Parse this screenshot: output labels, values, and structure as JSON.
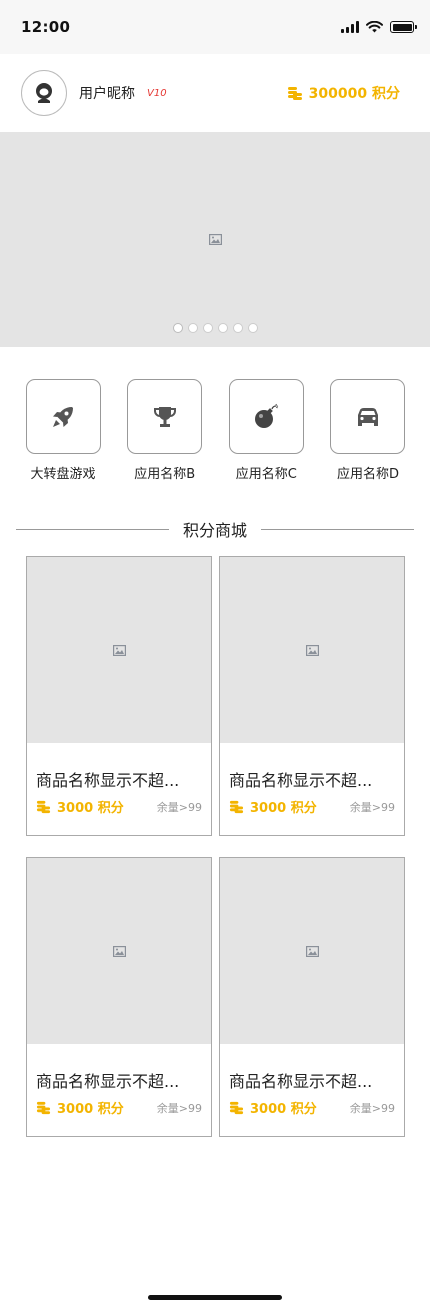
{
  "status_bar": {
    "time": "12:00"
  },
  "user": {
    "nickname": "用户昵称",
    "vip_label": "V10",
    "points": "300000 积分"
  },
  "banner": {
    "dot_count": 6,
    "active_dot": 0
  },
  "apps": [
    {
      "label": "大转盘游戏",
      "icon": "rocket-icon"
    },
    {
      "label": "应用名称B",
      "icon": "trophy-icon"
    },
    {
      "label": "应用名称C",
      "icon": "bomb-icon"
    },
    {
      "label": "应用名称D",
      "icon": "car-icon"
    }
  ],
  "section": {
    "title": "积分商城"
  },
  "products": [
    {
      "name": "商品名称显示不超...",
      "points": "3000 积分",
      "stock": "余量>99"
    },
    {
      "name": "商品名称显示不超...",
      "points": "3000 积分",
      "stock": "余量>99"
    },
    {
      "name": "商品名称显示不超...",
      "points": "3000 积分",
      "stock": "余量>99"
    },
    {
      "name": "商品名称显示不超...",
      "points": "3000 积分",
      "stock": "余量>99"
    }
  ],
  "colors": {
    "accent_gold": "#f3b400",
    "vip_red": "#e53935",
    "placeholder_gray": "#e4e4e4"
  }
}
